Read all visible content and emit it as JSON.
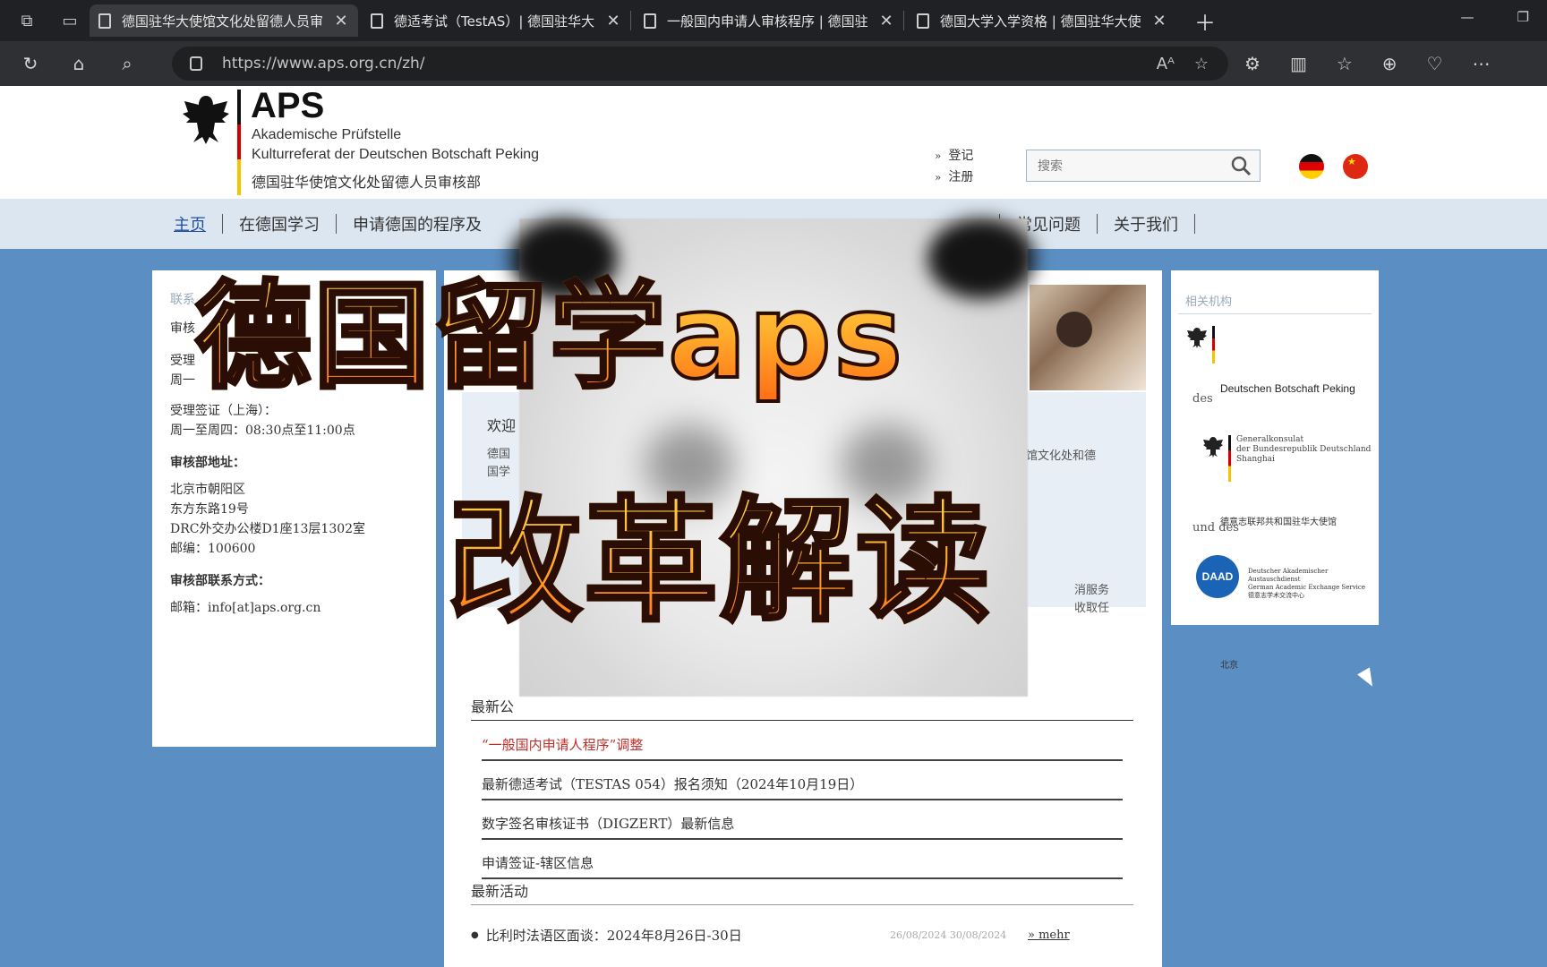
{
  "browser": {
    "tabs": [
      {
        "title": "德国驻华大使馆文化处留德人员审",
        "active": true
      },
      {
        "title": "德适考试（TestAS）| 德国驻华大",
        "active": false
      },
      {
        "title": "一般国内申请人审核程序 | 德国驻",
        "active": false
      },
      {
        "title": "德国大学入学资格 | 德国驻华大使",
        "active": false
      }
    ],
    "url": "https://www.aps.org.cn/zh/"
  },
  "header": {
    "brand": "APS",
    "line1": "Akademische Prüfstelle",
    "line2": "Kulturreferat der Deutschen Botschaft Peking",
    "line3": "德国驻华使馆文化处留德人员审核部",
    "login": "登记",
    "register": "注册",
    "search_placeholder": "搜索"
  },
  "menu": {
    "items": [
      "主页",
      "在德国学习",
      "申请德国的程序及",
      "常见问题",
      "关于我们"
    ]
  },
  "left": {
    "header": "联系",
    "l1": "审核",
    "l2": "受理",
    "l3": "周一",
    "shanghai_label": "受理签证（上海）：",
    "shanghai_hours": "周一至周四：08:30点至11:00点",
    "address_label": "审核部地址：",
    "addr1": "北京市朝阳区",
    "addr2": "东方东路19号",
    "addr3": "DRC外交办公楼D1座13层1302室",
    "addr4": "邮编：100600",
    "contact_label": "审核部联系方式：",
    "email": "邮箱：info[at]aps.org.cn"
  },
  "middle": {
    "welcome": "欢迎",
    "welcome_text_l1": "德国",
    "welcome_text_l2": "国学",
    "welcome_text_r": "馆文化处和德",
    "welcome_text_r2a": "消服务",
    "welcome_text_r2b": "收取任",
    "news_title": "最新公",
    "news": [
      "“一般国内申请人程序”调整",
      "最新德适考试（TESTAS 054）报名须知（2024年10月19日）",
      "数字签名审核证书（DIGZERT）最新信息",
      "申请签证-辖区信息"
    ],
    "activities_title": "最新活动",
    "activity": {
      "text": "比利时法语区面谈：2024年8月26日-30日",
      "date": "26/08/2024  30/08/2024",
      "more": "mehr"
    }
  },
  "right": {
    "header": "相关机构",
    "inst1_t1": "Deutschen Botschaft Peking",
    "inst1_t2": "德意志联邦共和国驻华大使馆",
    "inst1_t3": "北京",
    "des": "des",
    "inst2_l1": "Generalkonsulat",
    "inst2_l2": "der Bundesrepublik Deutschland",
    "inst2_l3": "Shanghai",
    "und_des": "und des",
    "daad": "DAAD",
    "daad_l1": "Deutscher Akademischer Austauschdienst",
    "daad_l2": "German Academic Exchange Service",
    "daad_l3": "德意志学术交流中心"
  },
  "overlay": {
    "title1": "德国留学aps",
    "title2": "改革解读"
  }
}
